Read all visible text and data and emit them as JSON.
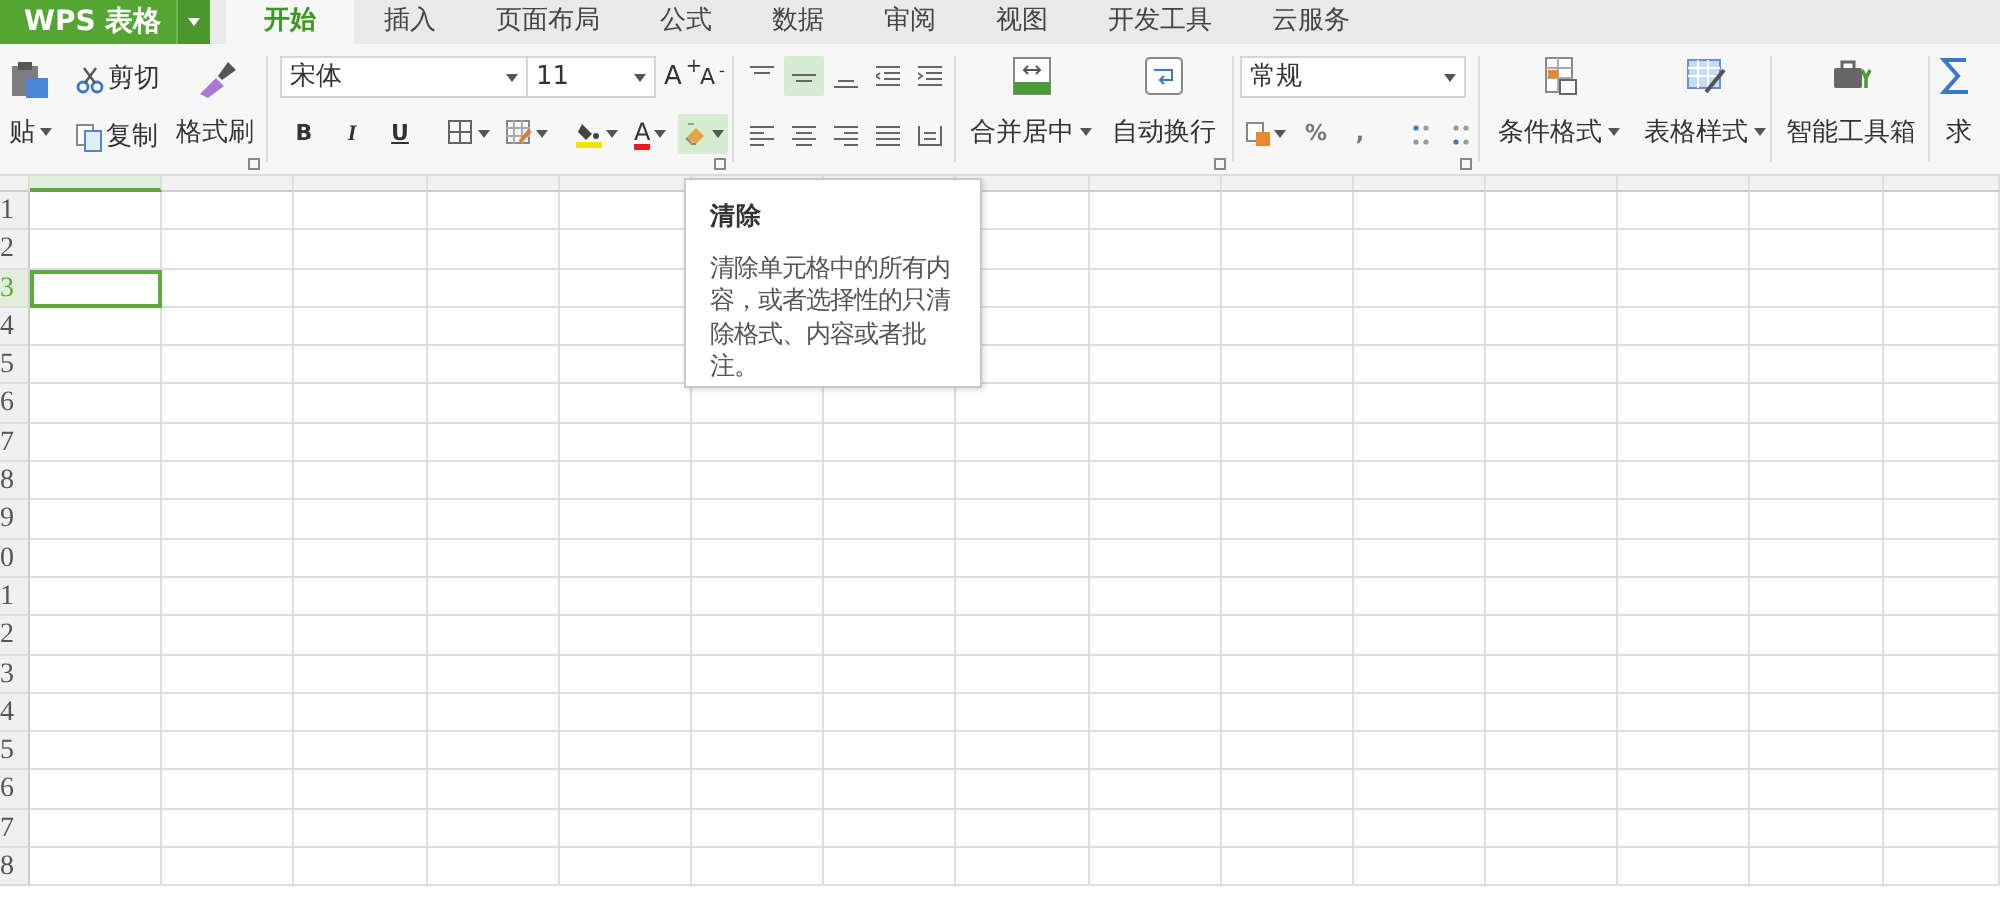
{
  "app": {
    "title": "WPS 表格",
    "menu_dropdown": true
  },
  "tabs": [
    {
      "label": "开始",
      "selected": true
    },
    {
      "label": "插入",
      "selected": false
    },
    {
      "label": "页面布局",
      "selected": false
    },
    {
      "label": "公式",
      "selected": false
    },
    {
      "label": "数据",
      "selected": false
    },
    {
      "label": "审阅",
      "selected": false
    },
    {
      "label": "视图",
      "selected": false
    },
    {
      "label": "开发工具",
      "selected": false
    },
    {
      "label": "云服务",
      "selected": false
    }
  ],
  "clipboard": {
    "paste": "贴",
    "cut": "剪切",
    "copy": "复制",
    "format_painter": "格式刷"
  },
  "font": {
    "name": "宋体",
    "size": "11",
    "grow": "A$^{+}$",
    "shrink": "A$^{-}$"
  },
  "font_tools": [
    {
      "kind": "text",
      "label": "B",
      "dropdown": false,
      "highlighted": false
    },
    {
      "kind": "text",
      "label": "I",
      "dropdown": false,
      "highlighted": false
    },
    {
      "kind": "text",
      "label": "U",
      "dropdown": false,
      "highlighted": false
    },
    {
      "kind": "borders",
      "dropdown": true,
      "highlighted": false
    },
    {
      "kind": "cell-style",
      "dropdown": true,
      "highlighted": false
    },
    {
      "kind": "fill-color",
      "dropdown": true,
      "highlighted": false
    },
    {
      "kind": "font-color",
      "label": "A",
      "dropdown": true,
      "highlighted": false
    },
    {
      "kind": "clear",
      "dropdown": true,
      "highlighted": true
    }
  ],
  "align_tools": [
    {
      "kind": "top",
      "selected": false
    },
    {
      "kind": "middle",
      "selected": true
    },
    {
      "kind": "bottom",
      "selected": false
    },
    {
      "kind": "outdent",
      "selected": false
    },
    {
      "kind": "indent",
      "selected": false
    },
    {
      "kind": "left",
      "selected": false
    },
    {
      "kind": "center",
      "selected": false
    },
    {
      "kind": "right",
      "selected": false
    },
    {
      "kind": "justify",
      "selected": false
    },
    {
      "kind": "distributed",
      "selected": false
    }
  ],
  "merge_buttons": [
    {
      "kind": "merge",
      "label": "合并居中",
      "dropdown": true
    },
    {
      "kind": "wrap",
      "label": "自动换行",
      "dropdown": false
    }
  ],
  "number": {
    "format": "常规"
  },
  "number_tools": [
    {
      "kind": "currency",
      "dropdown": true
    },
    {
      "kind": "text",
      "label": "%",
      "dropdown": false
    },
    {
      "kind": "text",
      "label": ",",
      "dropdown": false
    },
    {
      "kind": "inc-decimal",
      "dropdown": false
    },
    {
      "kind": "dec-decimal",
      "dropdown": false
    }
  ],
  "style_buttons": [
    {
      "kind": "conditional",
      "label": "条件格式",
      "dropdown": true
    },
    {
      "kind": "table-style",
      "label": "表格样式",
      "dropdown": true
    }
  ],
  "tool_buttons": [
    {
      "kind": "toolbox",
      "label": "智能工具箱",
      "dropdown": false
    },
    {
      "kind": "sum",
      "label": "求",
      "dropdown": false
    }
  ],
  "tooltip": {
    "title": "清除",
    "text": "清除单元格中的所有内容，或者选择性的只清除格式、内容或者批注。"
  },
  "grid": {
    "columns": [
      {
        "selected": true
      },
      {
        "selected": false
      },
      {
        "selected": false
      },
      {
        "selected": false
      },
      {
        "selected": false
      },
      {
        "selected": false
      },
      {
        "selected": false
      },
      {
        "selected": false
      },
      {
        "selected": false
      },
      {
        "selected": false
      },
      {
        "selected": false
      },
      {
        "selected": false
      },
      {
        "selected": false
      },
      {
        "selected": false
      },
      {
        "selected": false
      }
    ],
    "rows": [
      {
        "label": "1",
        "selected": false
      },
      {
        "label": "2",
        "selected": false
      },
      {
        "label": "3",
        "selected": true
      },
      {
        "label": "4",
        "selected": false
      },
      {
        "label": "5",
        "selected": false
      },
      {
        "label": "6",
        "selected": false
      },
      {
        "label": "7",
        "selected": false
      },
      {
        "label": "8",
        "selected": false
      },
      {
        "label": "9",
        "selected": false
      },
      {
        "label": "0",
        "selected": false
      },
      {
        "label": "1",
        "selected": false
      },
      {
        "label": "2",
        "selected": false
      },
      {
        "label": "3",
        "selected": false
      },
      {
        "label": "4",
        "selected": false
      },
      {
        "label": "5",
        "selected": false
      },
      {
        "label": "6",
        "selected": false
      },
      {
        "label": "7",
        "selected": false
      },
      {
        "label": "8",
        "selected": false
      }
    ]
  }
}
